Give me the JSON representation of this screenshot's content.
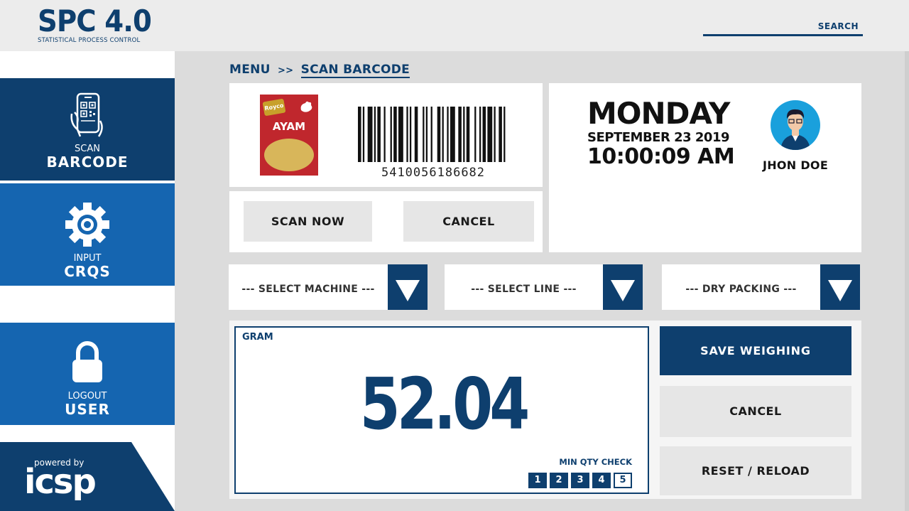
{
  "header": {
    "logo_title": "SPC 4.0",
    "logo_subtitle": "STATISTICAL PROCESS CONTROL",
    "search_label": "SEARCH"
  },
  "sidebar": {
    "items": [
      {
        "small": "SCAN",
        "big": "BARCODE",
        "icon": "qr-phone-icon"
      },
      {
        "small": "INPUT",
        "big": "CRQS",
        "icon": "gear-icon"
      },
      {
        "small": "LOGOUT",
        "big": "USER",
        "icon": "lock-icon"
      }
    ],
    "powered_small": "powered by",
    "powered_brand": "icsp"
  },
  "breadcrumb": {
    "root": "MENU",
    "separator": ">>",
    "current": "SCAN BARCODE"
  },
  "product": {
    "brand": "Royco",
    "flavor": "AYAM",
    "barcode": "5410056186682"
  },
  "scan_actions": {
    "scan_now": "SCAN NOW",
    "cancel": "CANCEL"
  },
  "info": {
    "day": "MONDAY",
    "date": "SEPTEMBER 23 2019",
    "time": "10:00:09 AM",
    "user_name": "JHON DOE"
  },
  "selects": {
    "machine": "--- SELECT MACHINE ---",
    "line": "--- SELECT LINE ---",
    "packing": "--- DRY PACKING ---"
  },
  "weighing": {
    "unit": "GRAM",
    "value": "52.04",
    "min_qty_label": "MIN QTY CHECK",
    "qty_steps": [
      "1",
      "2",
      "3",
      "4",
      "5"
    ],
    "active_step": "5",
    "save": "SAVE WEIGHING",
    "cancel": "CANCEL",
    "reset": "RESET / RELOAD"
  },
  "colors": {
    "primary_dark": "#0e3f6e",
    "primary": "#1565b0",
    "avatar_bg": "#1aa0dc",
    "product_red": "#c0272d"
  }
}
